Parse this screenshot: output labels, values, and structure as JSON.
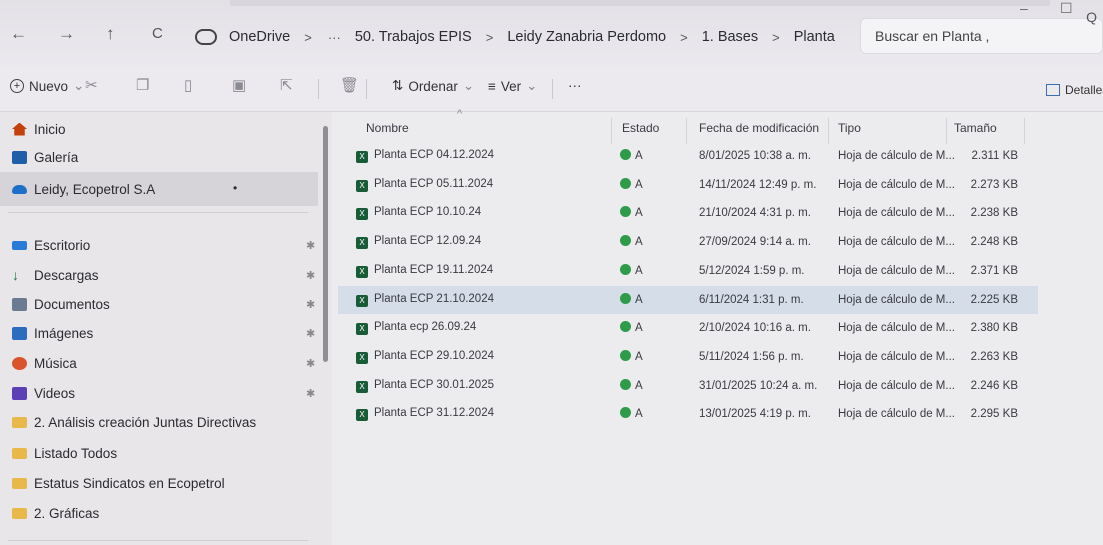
{
  "nav": {
    "back": "←",
    "forward": "→",
    "up": "↑",
    "refresh": "C"
  },
  "breadcrumb": {
    "items": [
      "OneDrive",
      "50. Trabajos EPIS",
      "Leidy Zanabria Perdomo",
      "1. Bases",
      "Planta"
    ],
    "sep": ">",
    "more": "···"
  },
  "search": {
    "placeholder": "Buscar en Planta ,",
    "glyph": "Q"
  },
  "commands": {
    "new": "Nuevo",
    "new_chevron": "⌄",
    "sort": "Ordenar",
    "view": "Ver",
    "more": "···",
    "details": "Detalles"
  },
  "sidebar": {
    "top": [
      {
        "label": "Inicio",
        "icon": "home-icon",
        "color": "#c2410c"
      },
      {
        "label": "Galería",
        "icon": "gallery-icon",
        "color": "#1e5fa8"
      },
      {
        "label": "Leidy, Ecopetrol S.A",
        "icon": "cloud-icon",
        "color": "#1e6fc8"
      }
    ],
    "pinned": [
      {
        "label": "Escritorio",
        "icon": "desktop-icon",
        "color": "#2b7bd6"
      },
      {
        "label": "Descargas",
        "icon": "download-icon",
        "color": "#1f7a3a"
      },
      {
        "label": "Documentos",
        "icon": "documents-icon",
        "color": "#6a7a90"
      },
      {
        "label": "Imágenes",
        "icon": "pictures-icon",
        "color": "#2b6cbf"
      },
      {
        "label": "Música",
        "icon": "music-icon",
        "color": "#d9532c"
      },
      {
        "label": "Videos",
        "icon": "videos-icon",
        "color": "#5b3fb5"
      }
    ],
    "folders": [
      {
        "label": "2. Análisis creación Juntas Directivas"
      },
      {
        "label": "Listado Todos"
      },
      {
        "label": "Estatus Sindicatos en Ecopetrol"
      },
      {
        "label": "2. Gráficas"
      }
    ],
    "pin_glyph": "✱",
    "selected": "Leidy, Ecopetrol S.A"
  },
  "table": {
    "headers": {
      "name": "Nombre",
      "status": "Estado",
      "modified": "Fecha de modificación",
      "type": "Tipo",
      "size": "Tamaño"
    },
    "rows": [
      {
        "name": "Planta ECP 04.12.2024",
        "status": "A",
        "modified": "8/01/2025 10:38 a. m.",
        "type": "Hoja de cálculo de M...",
        "size": "2.311 KB"
      },
      {
        "name": "Planta ECP 05.11.2024",
        "status": "A",
        "modified": "14/11/2024 12:49 p. m.",
        "type": "Hoja de cálculo de M...",
        "size": "2.273 KB"
      },
      {
        "name": "Planta ECP 10.10.24",
        "status": "A",
        "modified": "21/10/2024 4:31 p. m.",
        "type": "Hoja de cálculo de M...",
        "size": "2.238 KB"
      },
      {
        "name": "Planta ECP 12.09.24",
        "status": "A",
        "modified": "27/09/2024 9:14 a. m.",
        "type": "Hoja de cálculo de M...",
        "size": "2.248 KB"
      },
      {
        "name": "Planta ECP 19.11.2024",
        "status": "A",
        "modified": "5/12/2024 1:59 p. m.",
        "type": "Hoja de cálculo de M...",
        "size": "2.371 KB"
      },
      {
        "name": "Planta ECP 21.10.2024",
        "status": "A",
        "modified": "6/11/2024 1:31 p. m.",
        "type": "Hoja de cálculo de M...",
        "size": "2.225 KB"
      },
      {
        "name": "Planta ecp 26.09.24",
        "status": "A",
        "modified": "2/10/2024 10:16 a. m.",
        "type": "Hoja de cálculo de M...",
        "size": "2.380 KB"
      },
      {
        "name": "Planta ECP 29.10.2024",
        "status": "A",
        "modified": "5/11/2024 1:56 p. m.",
        "type": "Hoja de cálculo de M...",
        "size": "2.263 KB"
      },
      {
        "name": "Planta ECP 30.01.2025",
        "status": "A",
        "modified": "31/01/2025 10:24 a. m.",
        "type": "Hoja de cálculo de M...",
        "size": "2.246 KB"
      },
      {
        "name": "Planta ECP 31.12.2024",
        "status": "A",
        "modified": "13/01/2025 4:19 p. m.",
        "type": "Hoja de cálculo de M...",
        "size": "2.295 KB"
      }
    ],
    "highlighted_row": 5,
    "excel_glyph": "X"
  },
  "colors": {
    "accent": "#1e6fc8",
    "excel": "#185c37",
    "sync_ok": "#2e9a4a",
    "folder": "#e8b94a"
  }
}
